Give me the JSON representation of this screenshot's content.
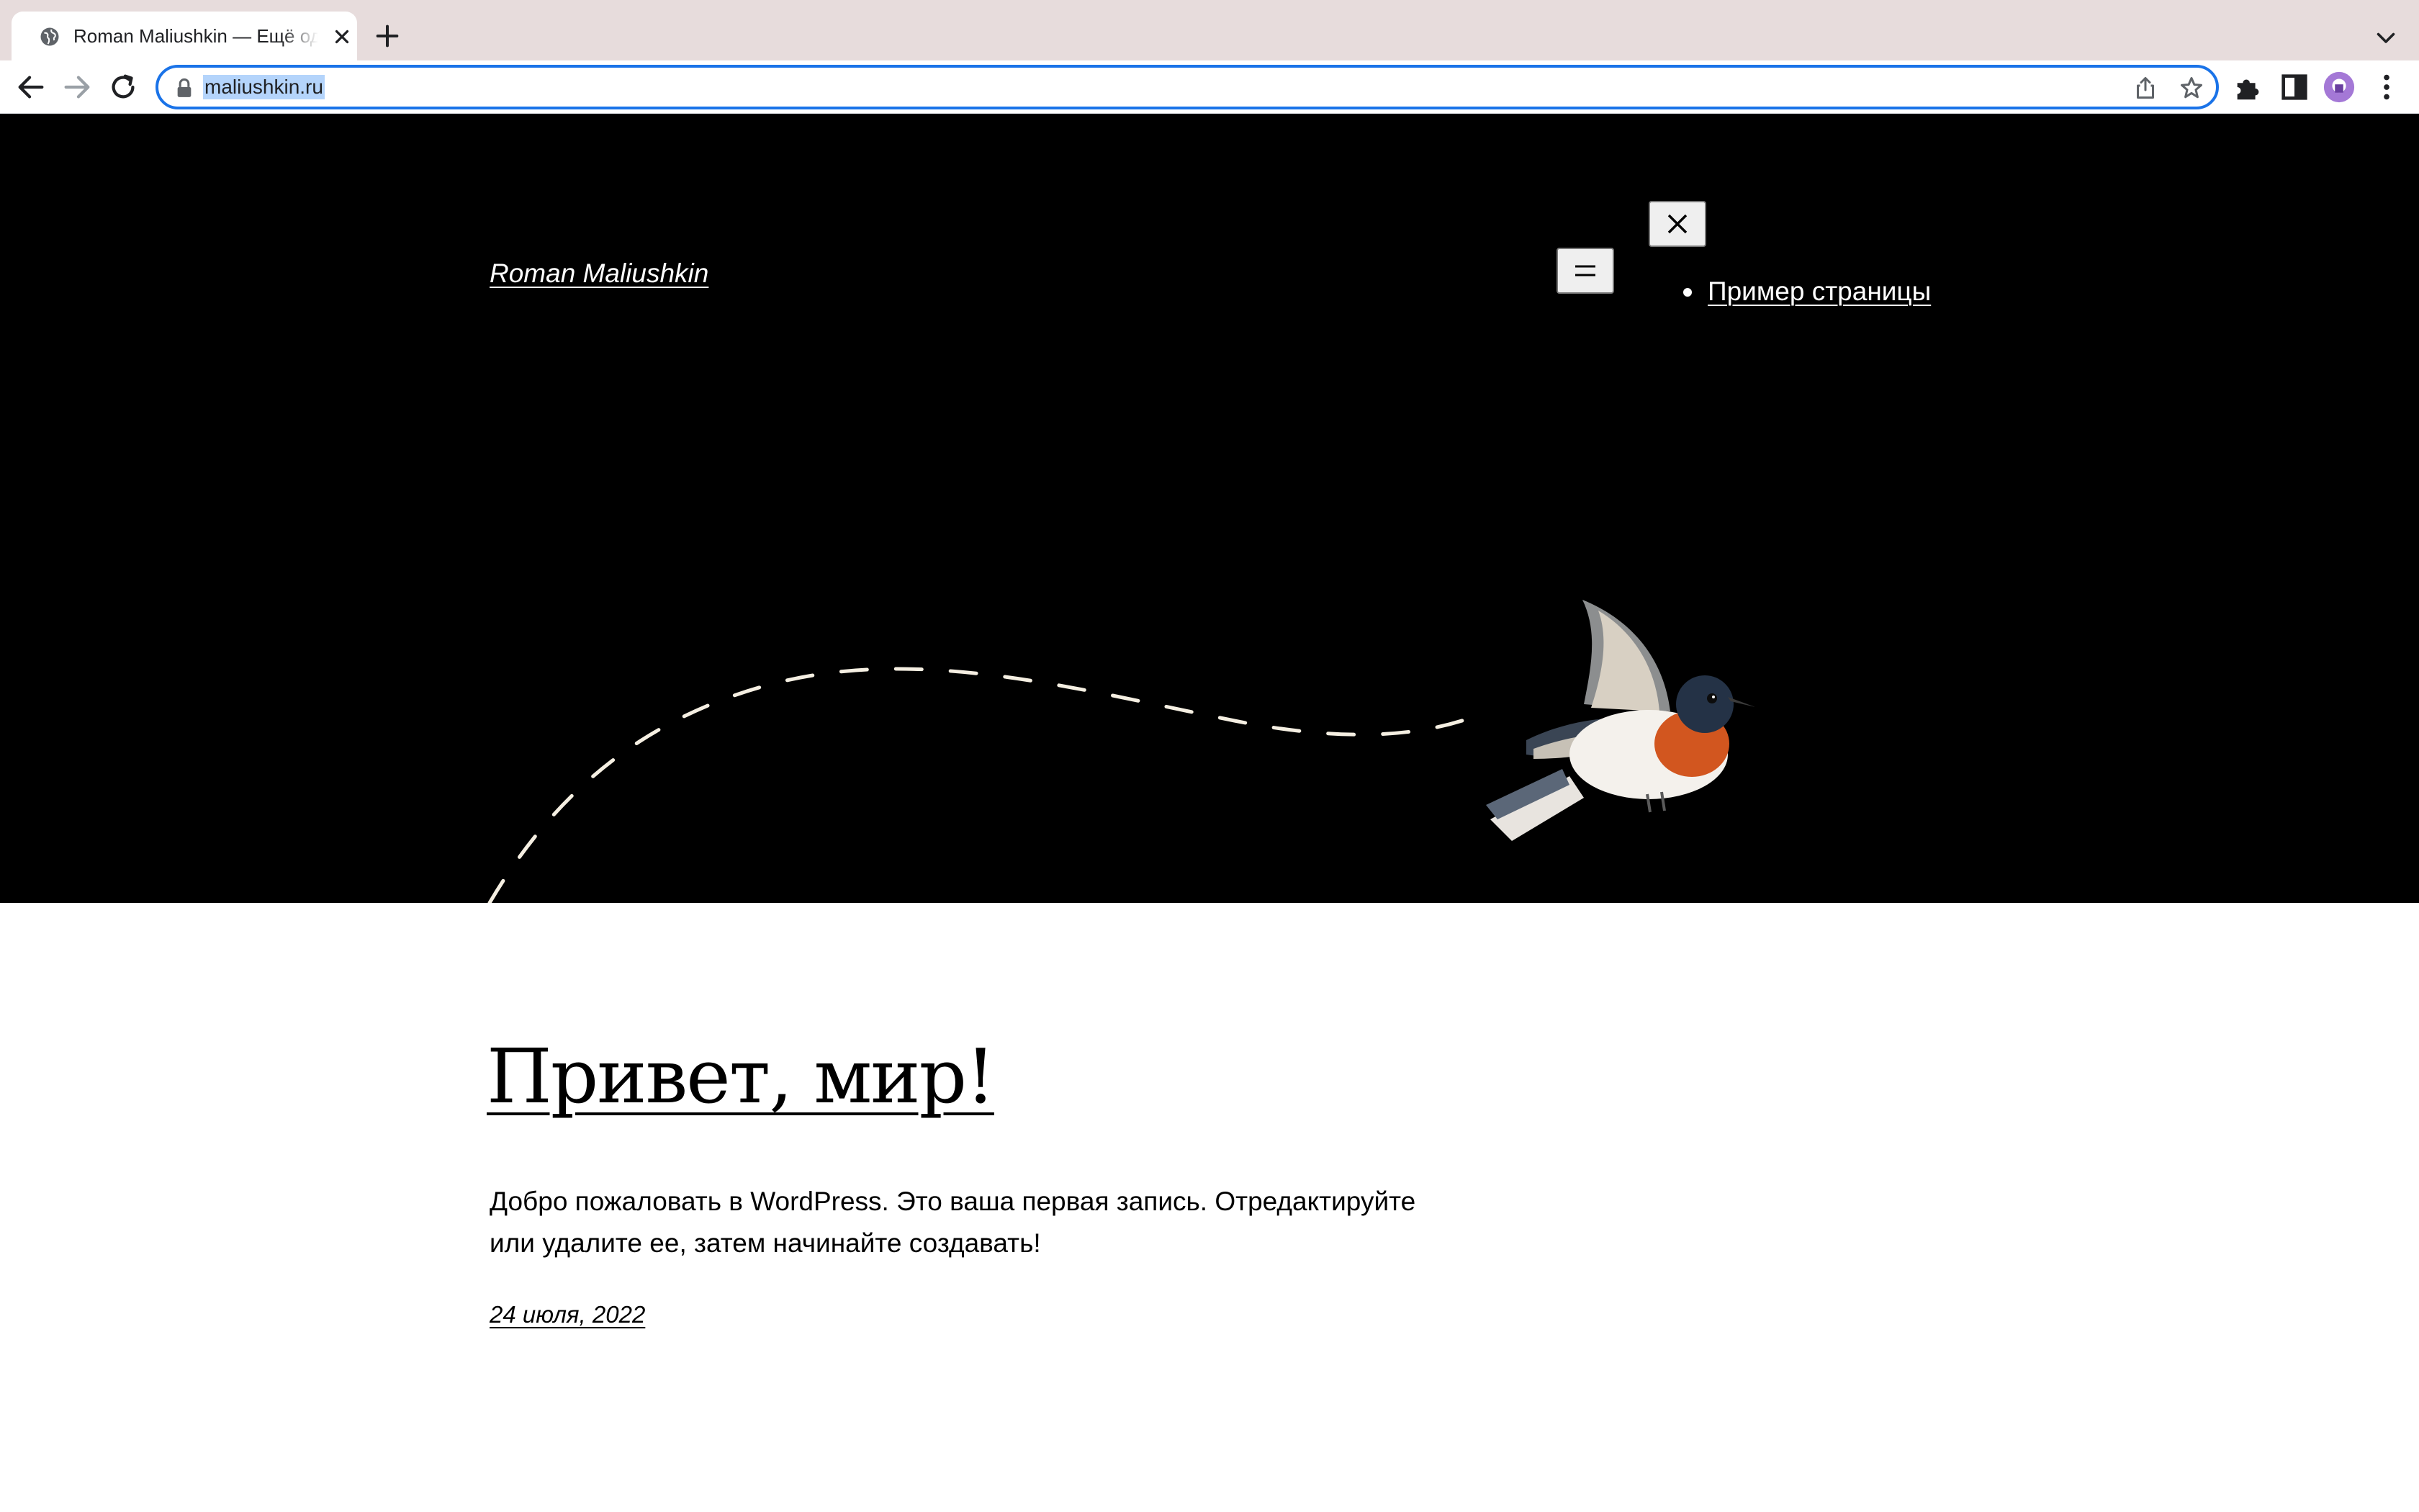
{
  "browser": {
    "tab_title": "Roman Maliushkin — Ещё один сайт на WordPress",
    "url": "maliushkin.ru",
    "icons": {
      "favicon": "globe-icon",
      "tab_close": "close-icon",
      "new_tab": "plus-icon",
      "tab_search": "chevron-down-icon",
      "back": "arrow-left-icon",
      "forward": "arrow-right-icon",
      "reload": "reload-icon",
      "lock": "lock-icon",
      "share": "share-icon",
      "bookmark": "star-icon",
      "extensions": "puzzle-icon",
      "side_panel": "side-panel-icon",
      "profile": "avatar",
      "menu": "kebab-menu-icon"
    },
    "colors": {
      "tabstrip": "#e7dcdc",
      "omnibox_focus": "#1a73e8",
      "url_selection": "#b4d4fb",
      "profile": "#a478d6"
    }
  },
  "header": {
    "site_title": "Roman Maliushkin",
    "menu_open_icon": "hamburger-icon",
    "menu_close_icon": "close-icon",
    "nav_items": [
      {
        "label": "Пример страницы"
      }
    ],
    "background": "#000000"
  },
  "post": {
    "title": "Привет, мир!",
    "excerpt": "Добро пожаловать в WordPress. Это ваша первая запись. Отредактируйте или удалите ее, затем начинайте создавать!",
    "date": "24 июля, 2022"
  }
}
